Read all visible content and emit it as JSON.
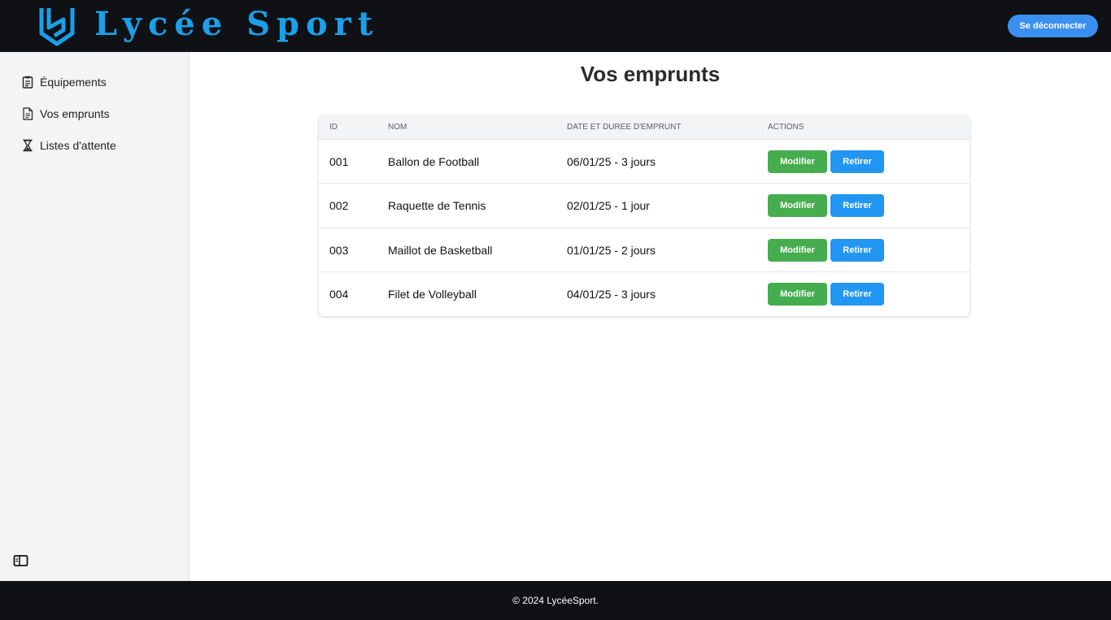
{
  "header": {
    "brand": "Lycée Sport",
    "logout_label": "Se déconnecter",
    "colors": {
      "background": "#0f1115",
      "brand": "#1aa0ea",
      "logout": "#3b8ff0"
    }
  },
  "sidebar": {
    "items": [
      {
        "label": "Équipements",
        "icon": "clipboard-list-icon"
      },
      {
        "label": "Vos emprunts",
        "icon": "document-icon"
      },
      {
        "label": "Listes d'attente",
        "icon": "hourglass-icon"
      }
    ],
    "collapse_icon": "sidebar-toggle-icon"
  },
  "main": {
    "title": "Vos emprunts",
    "table": {
      "headers": [
        "ID",
        "NOM",
        "DATE ET DUREE D'EMPRUNT",
        "ACTIONS"
      ],
      "rows": [
        {
          "id": "001",
          "name": "Ballon de Football",
          "date": "06/01/25 - 3 jours"
        },
        {
          "id": "002",
          "name": "Raquette de Tennis",
          "date": "02/01/25 - 1 jour"
        },
        {
          "id": "003",
          "name": "Maillot de Basketball",
          "date": "01/01/25 - 2 jours"
        },
        {
          "id": "004",
          "name": "Filet de Volleyball",
          "date": "04/01/25 - 3 jours"
        }
      ],
      "modify_label": "Modifier",
      "remove_label": "Retirer",
      "colors": {
        "modify": "#46ad4f",
        "remove": "#2196f3"
      }
    }
  },
  "footer": {
    "text": "© 2024 LycéeSport."
  }
}
